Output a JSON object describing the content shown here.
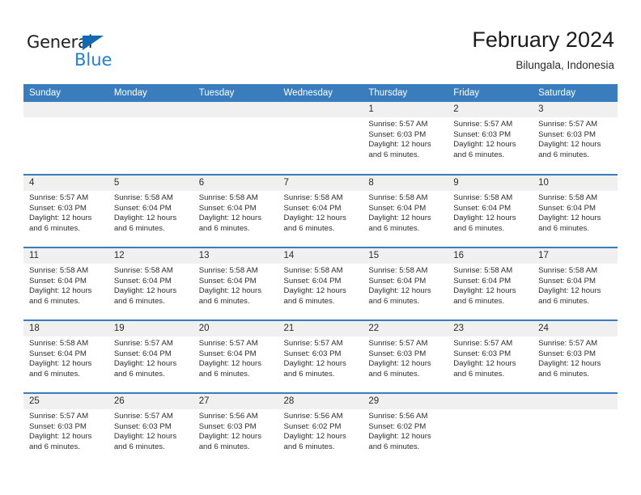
{
  "brand": {
    "name_dark": "General",
    "name_blue": "Blue",
    "accent_color": "#1268b3",
    "blue_text_color": "#2180d4"
  },
  "header": {
    "title": "February 2024",
    "subtitle": "Bilungala, Indonesia"
  },
  "calendar": {
    "header_bg": "#3a7dbf",
    "daynum_bg": "#f0f0f0",
    "weekdays": [
      "Sunday",
      "Monday",
      "Tuesday",
      "Wednesday",
      "Thursday",
      "Friday",
      "Saturday"
    ],
    "weeks": [
      [
        {
          "day": "",
          "sunrise": "",
          "sunset": "",
          "daylight_1": "",
          "daylight_2": ""
        },
        {
          "day": "",
          "sunrise": "",
          "sunset": "",
          "daylight_1": "",
          "daylight_2": ""
        },
        {
          "day": "",
          "sunrise": "",
          "sunset": "",
          "daylight_1": "",
          "daylight_2": ""
        },
        {
          "day": "",
          "sunrise": "",
          "sunset": "",
          "daylight_1": "",
          "daylight_2": ""
        },
        {
          "day": "1",
          "sunrise": "Sunrise: 5:57 AM",
          "sunset": "Sunset: 6:03 PM",
          "daylight_1": "Daylight: 12 hours",
          "daylight_2": "and 6 minutes."
        },
        {
          "day": "2",
          "sunrise": "Sunrise: 5:57 AM",
          "sunset": "Sunset: 6:03 PM",
          "daylight_1": "Daylight: 12 hours",
          "daylight_2": "and 6 minutes."
        },
        {
          "day": "3",
          "sunrise": "Sunrise: 5:57 AM",
          "sunset": "Sunset: 6:03 PM",
          "daylight_1": "Daylight: 12 hours",
          "daylight_2": "and 6 minutes."
        }
      ],
      [
        {
          "day": "4",
          "sunrise": "Sunrise: 5:57 AM",
          "sunset": "Sunset: 6:03 PM",
          "daylight_1": "Daylight: 12 hours",
          "daylight_2": "and 6 minutes."
        },
        {
          "day": "5",
          "sunrise": "Sunrise: 5:58 AM",
          "sunset": "Sunset: 6:04 PM",
          "daylight_1": "Daylight: 12 hours",
          "daylight_2": "and 6 minutes."
        },
        {
          "day": "6",
          "sunrise": "Sunrise: 5:58 AM",
          "sunset": "Sunset: 6:04 PM",
          "daylight_1": "Daylight: 12 hours",
          "daylight_2": "and 6 minutes."
        },
        {
          "day": "7",
          "sunrise": "Sunrise: 5:58 AM",
          "sunset": "Sunset: 6:04 PM",
          "daylight_1": "Daylight: 12 hours",
          "daylight_2": "and 6 minutes."
        },
        {
          "day": "8",
          "sunrise": "Sunrise: 5:58 AM",
          "sunset": "Sunset: 6:04 PM",
          "daylight_1": "Daylight: 12 hours",
          "daylight_2": "and 6 minutes."
        },
        {
          "day": "9",
          "sunrise": "Sunrise: 5:58 AM",
          "sunset": "Sunset: 6:04 PM",
          "daylight_1": "Daylight: 12 hours",
          "daylight_2": "and 6 minutes."
        },
        {
          "day": "10",
          "sunrise": "Sunrise: 5:58 AM",
          "sunset": "Sunset: 6:04 PM",
          "daylight_1": "Daylight: 12 hours",
          "daylight_2": "and 6 minutes."
        }
      ],
      [
        {
          "day": "11",
          "sunrise": "Sunrise: 5:58 AM",
          "sunset": "Sunset: 6:04 PM",
          "daylight_1": "Daylight: 12 hours",
          "daylight_2": "and 6 minutes."
        },
        {
          "day": "12",
          "sunrise": "Sunrise: 5:58 AM",
          "sunset": "Sunset: 6:04 PM",
          "daylight_1": "Daylight: 12 hours",
          "daylight_2": "and 6 minutes."
        },
        {
          "day": "13",
          "sunrise": "Sunrise: 5:58 AM",
          "sunset": "Sunset: 6:04 PM",
          "daylight_1": "Daylight: 12 hours",
          "daylight_2": "and 6 minutes."
        },
        {
          "day": "14",
          "sunrise": "Sunrise: 5:58 AM",
          "sunset": "Sunset: 6:04 PM",
          "daylight_1": "Daylight: 12 hours",
          "daylight_2": "and 6 minutes."
        },
        {
          "day": "15",
          "sunrise": "Sunrise: 5:58 AM",
          "sunset": "Sunset: 6:04 PM",
          "daylight_1": "Daylight: 12 hours",
          "daylight_2": "and 6 minutes."
        },
        {
          "day": "16",
          "sunrise": "Sunrise: 5:58 AM",
          "sunset": "Sunset: 6:04 PM",
          "daylight_1": "Daylight: 12 hours",
          "daylight_2": "and 6 minutes."
        },
        {
          "day": "17",
          "sunrise": "Sunrise: 5:58 AM",
          "sunset": "Sunset: 6:04 PM",
          "daylight_1": "Daylight: 12 hours",
          "daylight_2": "and 6 minutes."
        }
      ],
      [
        {
          "day": "18",
          "sunrise": "Sunrise: 5:58 AM",
          "sunset": "Sunset: 6:04 PM",
          "daylight_1": "Daylight: 12 hours",
          "daylight_2": "and 6 minutes."
        },
        {
          "day": "19",
          "sunrise": "Sunrise: 5:57 AM",
          "sunset": "Sunset: 6:04 PM",
          "daylight_1": "Daylight: 12 hours",
          "daylight_2": "and 6 minutes."
        },
        {
          "day": "20",
          "sunrise": "Sunrise: 5:57 AM",
          "sunset": "Sunset: 6:04 PM",
          "daylight_1": "Daylight: 12 hours",
          "daylight_2": "and 6 minutes."
        },
        {
          "day": "21",
          "sunrise": "Sunrise: 5:57 AM",
          "sunset": "Sunset: 6:03 PM",
          "daylight_1": "Daylight: 12 hours",
          "daylight_2": "and 6 minutes."
        },
        {
          "day": "22",
          "sunrise": "Sunrise: 5:57 AM",
          "sunset": "Sunset: 6:03 PM",
          "daylight_1": "Daylight: 12 hours",
          "daylight_2": "and 6 minutes."
        },
        {
          "day": "23",
          "sunrise": "Sunrise: 5:57 AM",
          "sunset": "Sunset: 6:03 PM",
          "daylight_1": "Daylight: 12 hours",
          "daylight_2": "and 6 minutes."
        },
        {
          "day": "24",
          "sunrise": "Sunrise: 5:57 AM",
          "sunset": "Sunset: 6:03 PM",
          "daylight_1": "Daylight: 12 hours",
          "daylight_2": "and 6 minutes."
        }
      ],
      [
        {
          "day": "25",
          "sunrise": "Sunrise: 5:57 AM",
          "sunset": "Sunset: 6:03 PM",
          "daylight_1": "Daylight: 12 hours",
          "daylight_2": "and 6 minutes."
        },
        {
          "day": "26",
          "sunrise": "Sunrise: 5:57 AM",
          "sunset": "Sunset: 6:03 PM",
          "daylight_1": "Daylight: 12 hours",
          "daylight_2": "and 6 minutes."
        },
        {
          "day": "27",
          "sunrise": "Sunrise: 5:56 AM",
          "sunset": "Sunset: 6:03 PM",
          "daylight_1": "Daylight: 12 hours",
          "daylight_2": "and 6 minutes."
        },
        {
          "day": "28",
          "sunrise": "Sunrise: 5:56 AM",
          "sunset": "Sunset: 6:02 PM",
          "daylight_1": "Daylight: 12 hours",
          "daylight_2": "and 6 minutes."
        },
        {
          "day": "29",
          "sunrise": "Sunrise: 5:56 AM",
          "sunset": "Sunset: 6:02 PM",
          "daylight_1": "Daylight: 12 hours",
          "daylight_2": "and 6 minutes."
        },
        {
          "day": "",
          "sunrise": "",
          "sunset": "",
          "daylight_1": "",
          "daylight_2": ""
        },
        {
          "day": "",
          "sunrise": "",
          "sunset": "",
          "daylight_1": "",
          "daylight_2": ""
        }
      ]
    ]
  }
}
